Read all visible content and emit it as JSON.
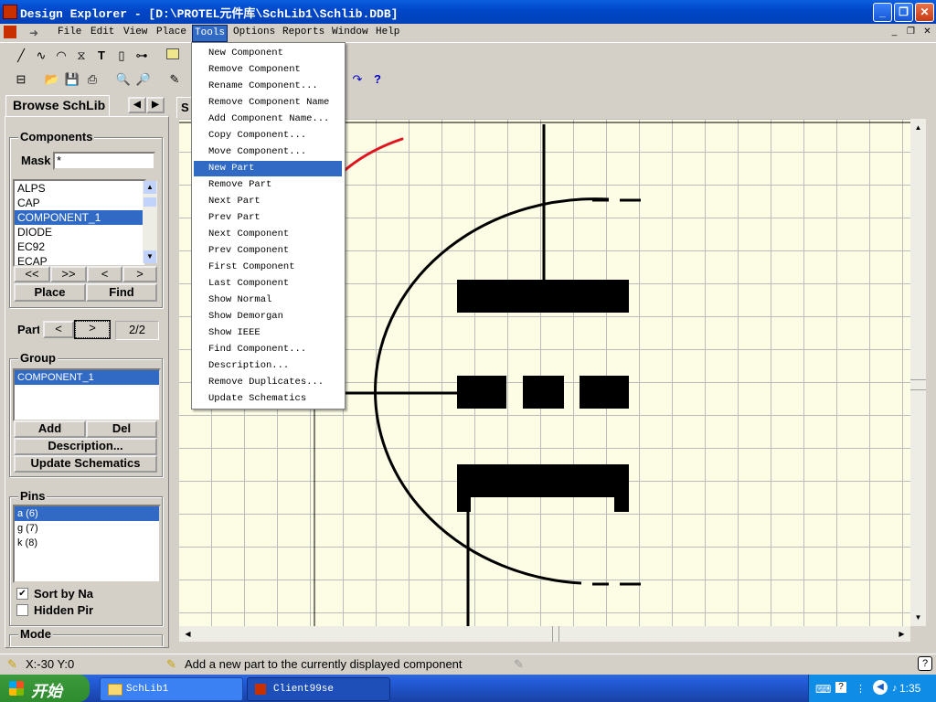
{
  "window": {
    "title": "Design Explorer - [D:\\PROTEL元件库\\SchLib1\\Schlib.DDB]",
    "minimize": "_",
    "maximize": "❐",
    "close": "✕"
  },
  "menubar": {
    "items": [
      "File",
      "Edit",
      "View",
      "Place",
      "Tools",
      "Options",
      "Reports",
      "Window",
      "Help"
    ],
    "active": "Tools"
  },
  "tools_menu": {
    "items": [
      "New Component",
      "Remove Component",
      "Rename Component...",
      "Remove Component Name",
      "Add Component Name...",
      "Copy Component...",
      "Move Component...",
      "New Part",
      "Remove Part",
      "Next Part",
      "Prev Part",
      "Next Component",
      "Prev Component",
      "First Component",
      "Last Component",
      "Show Normal",
      "Show Demorgan",
      "Show IEEE",
      "Find Component...",
      "Description...",
      "Remove Duplicates...",
      "Update Schematics"
    ],
    "highlighted": "New Part"
  },
  "browser": {
    "tab_label": "Browse SchLib",
    "components_label": "Components",
    "mask_label": "Mask",
    "mask_value": "*",
    "component_list": [
      "ALPS",
      "CAP",
      "COMPONENT_1",
      "DIODE",
      "EC92",
      "ECAP"
    ],
    "selected_component": "COMPONENT_1",
    "nav_buttons": [
      "<<",
      ">>",
      "<",
      ">"
    ],
    "place_button": "Place",
    "find_button": "Find",
    "part_label": "Part",
    "part_prev": "<",
    "part_next": ">",
    "part_count": "2/2",
    "group_label": "Group",
    "group_list": [
      "COMPONENT_1"
    ],
    "add_button": "Add",
    "del_button": "Del",
    "description_button": "Description...",
    "update_button": "Update Schematics",
    "pins_label": "Pins",
    "pins_list": [
      "a  (6)",
      "g  (7)",
      "k  (8)"
    ],
    "sort_label": "Sort by Na",
    "sort_checked": true,
    "hidden_label": "Hidden Pir",
    "hidden_checked": false,
    "mode_label": "Mode"
  },
  "sheet_tab": "S",
  "status": {
    "coords": "X:-30 Y:0",
    "message": "Add a new part to the currently displayed component"
  },
  "taskbar": {
    "start_label": "开始",
    "tasks": [
      "SchLib1",
      "Client99se"
    ],
    "clock": "1:35"
  }
}
